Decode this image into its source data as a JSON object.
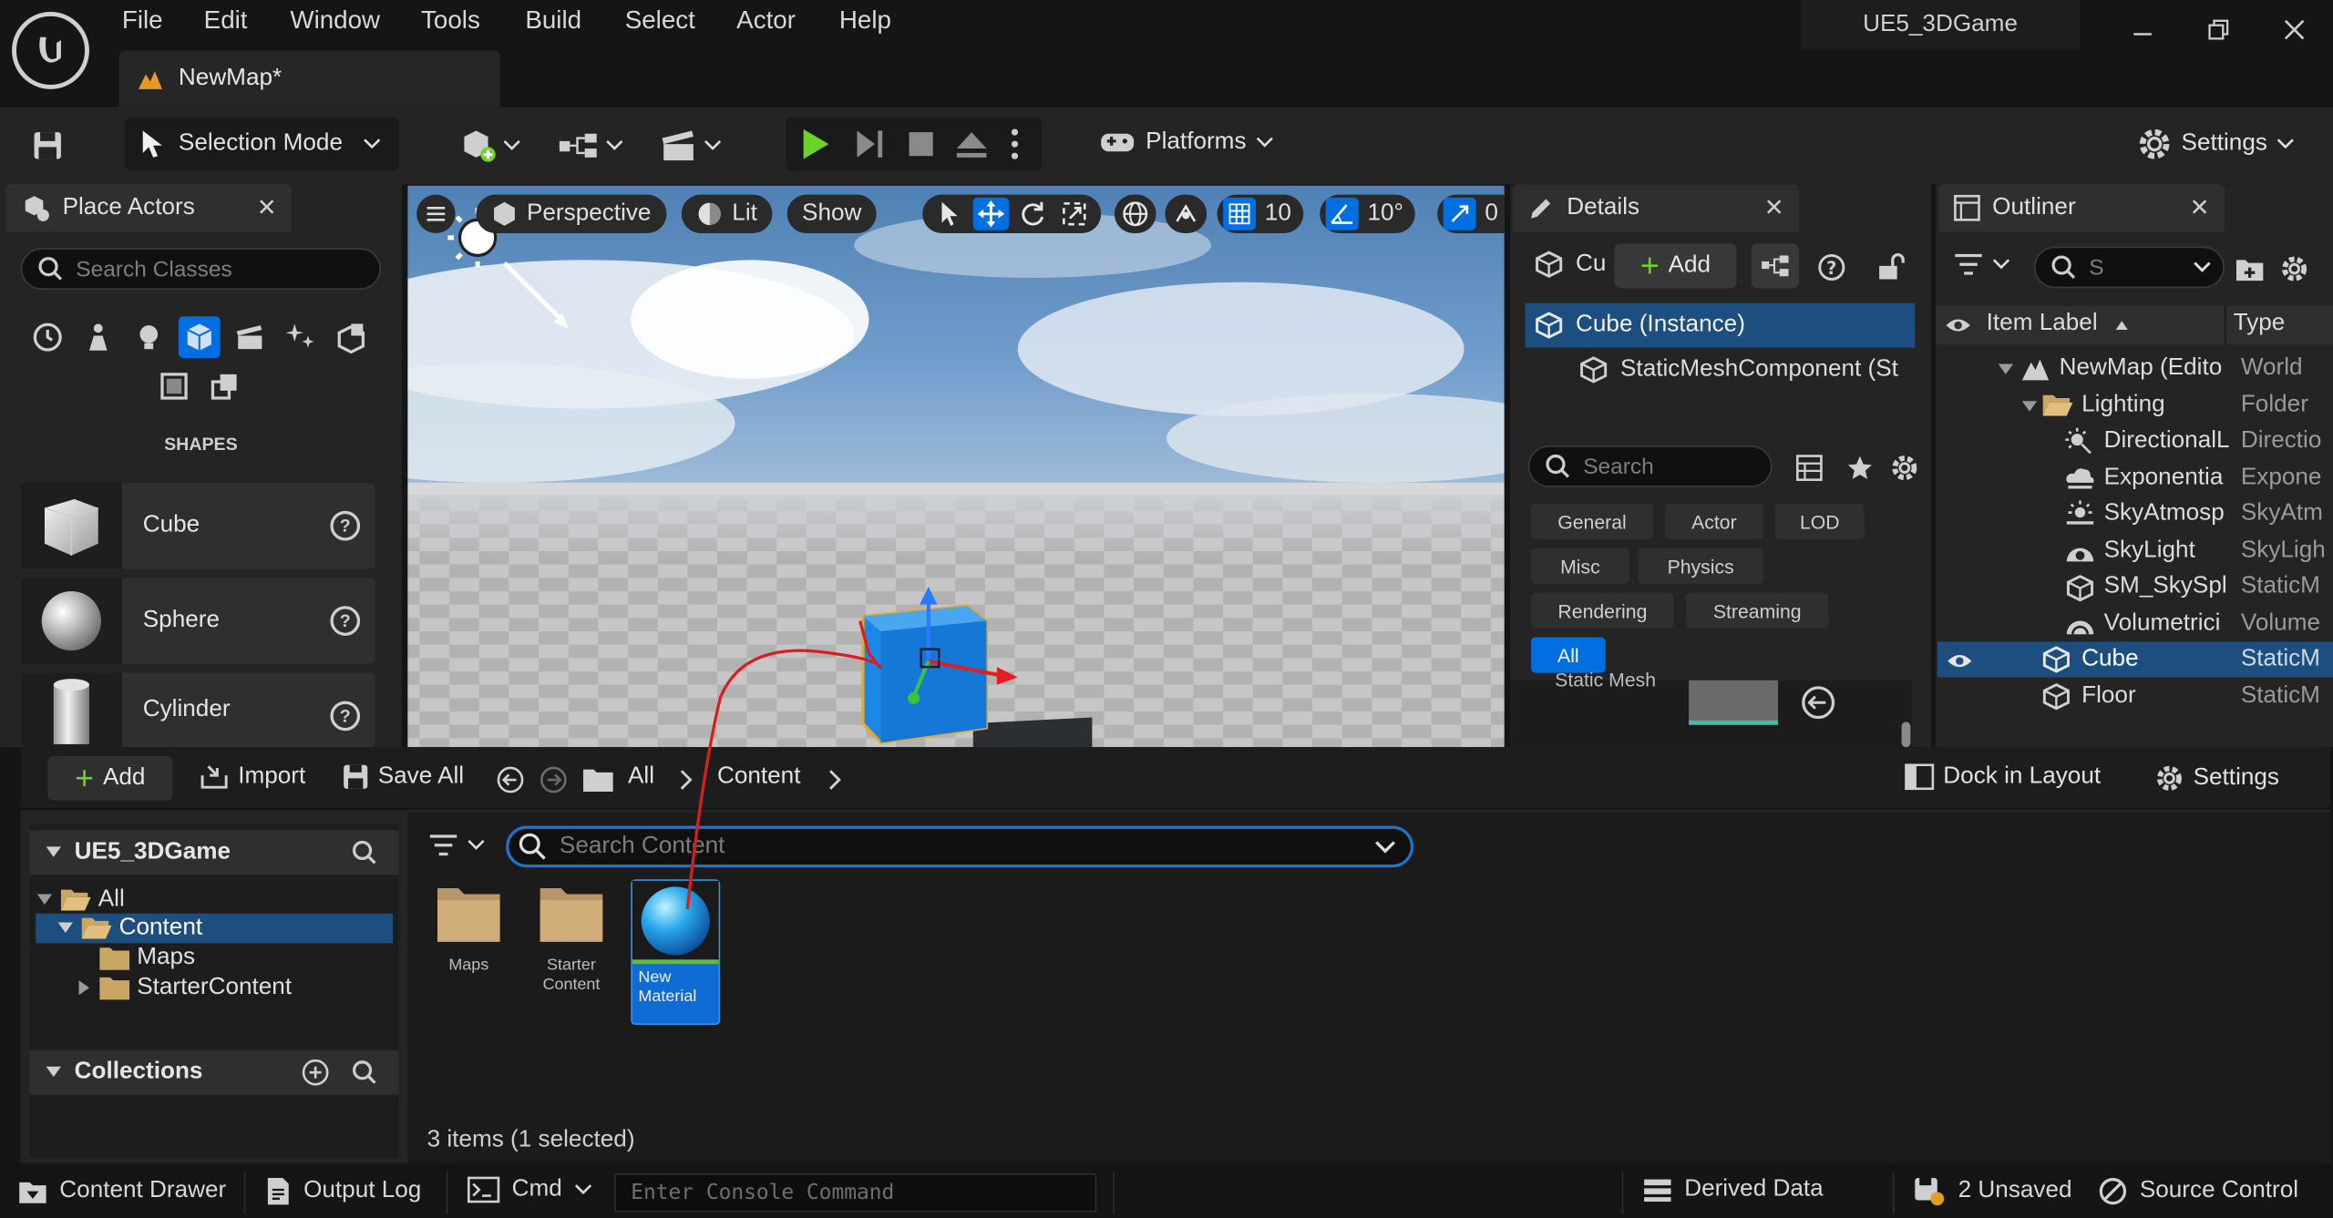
{
  "app": {
    "project_name": "UE5_3DGame",
    "map_tab": "NewMap*",
    "menu": [
      "File",
      "Edit",
      "Window",
      "Tools",
      "Build",
      "Select",
      "Actor",
      "Help"
    ]
  },
  "toolbar": {
    "selection_mode": "Selection Mode",
    "platforms": "Platforms",
    "settings": "Settings"
  },
  "place_actors": {
    "tab_title": "Place Actors",
    "search_placeholder": "Search Classes",
    "category_title": "SHAPES",
    "shapes": [
      {
        "label": "Cube"
      },
      {
        "label": "Sphere"
      },
      {
        "label": "Cylinder"
      }
    ]
  },
  "viewport": {
    "perspective": "Perspective",
    "lit": "Lit",
    "show": "Show",
    "grid_snap": "10",
    "rotation_snap": "10°",
    "scale_snap": "0"
  },
  "details": {
    "tab_title": "Details",
    "object_short": "Cu",
    "add_label": "Add",
    "instance": "Cube (Instance)",
    "component": "StaticMeshComponent (St",
    "search_placeholder": "Search",
    "filters": [
      "General",
      "Actor",
      "LOD",
      "Misc",
      "Physics",
      "Rendering",
      "Streaming",
      "All"
    ],
    "partial_label": "Static Mesh"
  },
  "outliner": {
    "tab_title": "Outliner",
    "search_placeholder": "S",
    "col_label": "Item Label",
    "col_type": "Type",
    "rows": [
      {
        "label": "NewMap (Edito",
        "type": "World"
      },
      {
        "label": "Lighting",
        "type": "Folder"
      },
      {
        "label": "DirectionalL",
        "type": "Directio"
      },
      {
        "label": "Exponentia",
        "type": "Expone"
      },
      {
        "label": "SkyAtmosp",
        "type": "SkyAtm"
      },
      {
        "label": "SkyLight",
        "type": "SkyLigh"
      },
      {
        "label": "SM_SkySpl",
        "type": "StaticM"
      },
      {
        "label": "Volumetrici",
        "type": "Volume"
      },
      {
        "label": "Cube",
        "type": "StaticM"
      },
      {
        "label": "Floor",
        "type": "StaticM"
      }
    ]
  },
  "content_browser": {
    "add": "Add",
    "import": "Import",
    "save_all": "Save All",
    "crumb_all": "All",
    "crumb_content": "Content",
    "dock": "Dock in Layout",
    "settings": "Settings",
    "project_root": "UE5_3DGame",
    "tree": [
      "All",
      "Content",
      "Maps",
      "StarterContent"
    ],
    "collections": "Collections",
    "search_placeholder": "Search Content",
    "assets": [
      {
        "label": "Maps"
      },
      {
        "label": "Starter\nContent"
      },
      {
        "label": "New\nMaterial"
      }
    ],
    "status": "3 items (1 selected)"
  },
  "statusbar": {
    "content_drawer": "Content Drawer",
    "output_log": "Output Log",
    "cmd": "Cmd",
    "console_placeholder": "Enter Console Command",
    "derived_data": "Derived Data",
    "unsaved": "2 Unsaved",
    "source_control": "Source Control"
  },
  "colors": {
    "accent": "#0070e0",
    "selection": "#1c4f7f",
    "play_green": "#6bd22a",
    "folder": "#c8a664"
  }
}
